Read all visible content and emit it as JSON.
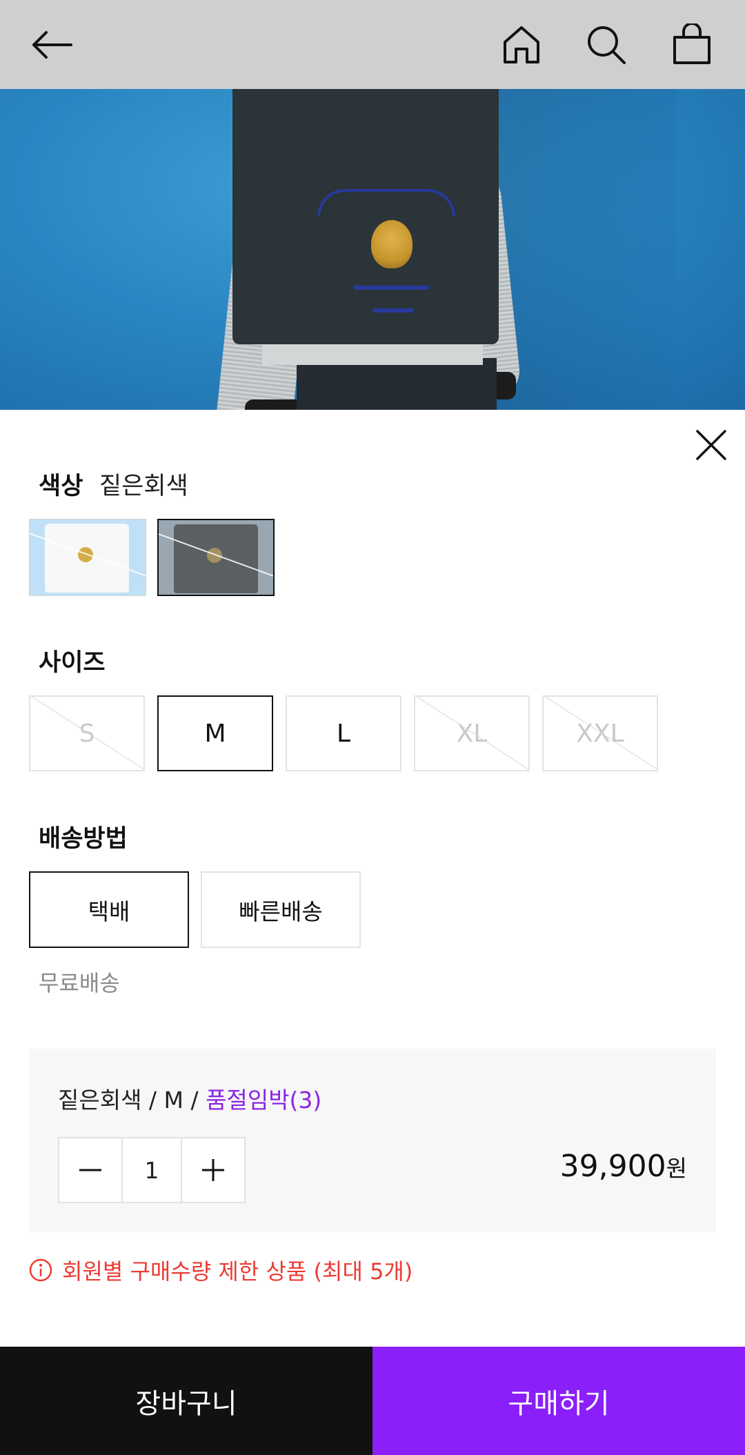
{
  "header": {
    "icons": [
      "arrow-left-icon",
      "home-icon",
      "search-icon",
      "shopping-bag-icon"
    ]
  },
  "options": {
    "color": {
      "label": "색상",
      "selected_value": "짙은회색",
      "swatches": [
        {
          "name": "white",
          "sold_out": true
        },
        {
          "name": "짙은회색",
          "selected": true,
          "sold_out": true
        }
      ]
    },
    "size": {
      "label": "사이즈",
      "items": [
        {
          "label": "S",
          "disabled": true
        },
        {
          "label": "M",
          "selected": true
        },
        {
          "label": "L"
        },
        {
          "label": "XL",
          "disabled": true
        },
        {
          "label": "XXL",
          "disabled": true
        }
      ]
    },
    "shipping": {
      "label": "배송방법",
      "items": [
        {
          "label": "택배",
          "selected": true
        },
        {
          "label": "빠른배송"
        }
      ],
      "note": "무료배송"
    }
  },
  "order": {
    "summary_prefix": "짙은회색 / M / ",
    "stock_text": "품절임박(3)",
    "quantity": "1",
    "price": "39,900",
    "currency": "원"
  },
  "notice": {
    "text": "회원별 구매수량 제한 상품 (최대 5개)"
  },
  "actions": {
    "cart_label": "장바구니",
    "buy_label": "구매하기"
  },
  "colors": {
    "accent": "#8a1ff9",
    "stock": "#8a22e6",
    "warning": "#ec3b32",
    "cart_bg": "#111111",
    "topbar_bg": "#cfcfcf"
  }
}
